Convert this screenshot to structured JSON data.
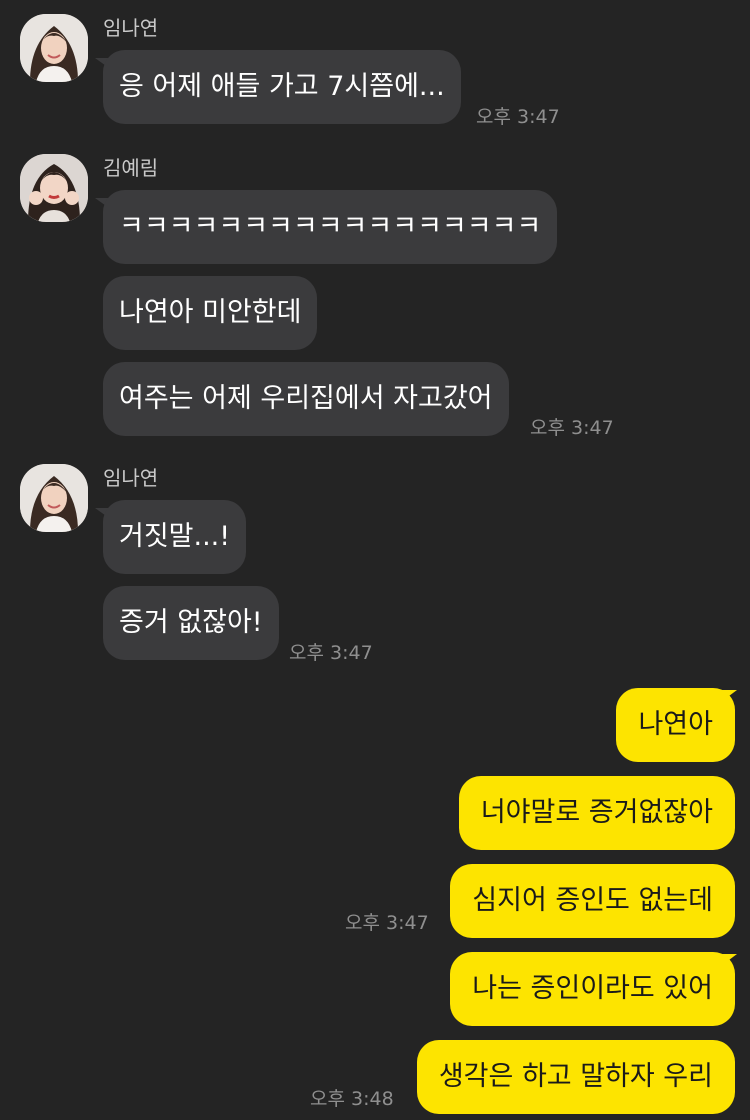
{
  "messages": {
    "g1": {
      "sender": "임나연",
      "texts": [
        "응 어제 애들 가고 7시쯤에..."
      ],
      "time": "오후 3:47"
    },
    "g2": {
      "sender": "김예림",
      "texts": [
        "ㅋㅋㅋㅋㅋㅋㅋㅋㅋㅋㅋㅋㅋㅋㅋㅋㅋ",
        "나연아 미안한데",
        "여주는 어제 우리집에서 자고갔어"
      ],
      "time": "오후 3:47"
    },
    "g3": {
      "sender": "임나연",
      "texts": [
        "거짓말...!",
        "증거 없잖아!"
      ],
      "time": "오후 3:47"
    },
    "g4": {
      "texts": [
        "나연아",
        "너야말로 증거없잖아",
        "심지어 증인도 없는데"
      ],
      "time": "오후 3:47"
    },
    "g5": {
      "texts": [
        "나는 증인이라도 있어",
        "생각은 하고 말하자 우리"
      ],
      "time": "오후 3:48"
    }
  },
  "icons": {
    "avatar_nayeon": "profile-photo-woman",
    "avatar_yerim": "profile-photo-woman"
  },
  "colors": {
    "background": "#242424",
    "incoming_bubble": "#3b3b3d",
    "outgoing_bubble": "#fde400",
    "timestamp": "#8f8f8f"
  }
}
